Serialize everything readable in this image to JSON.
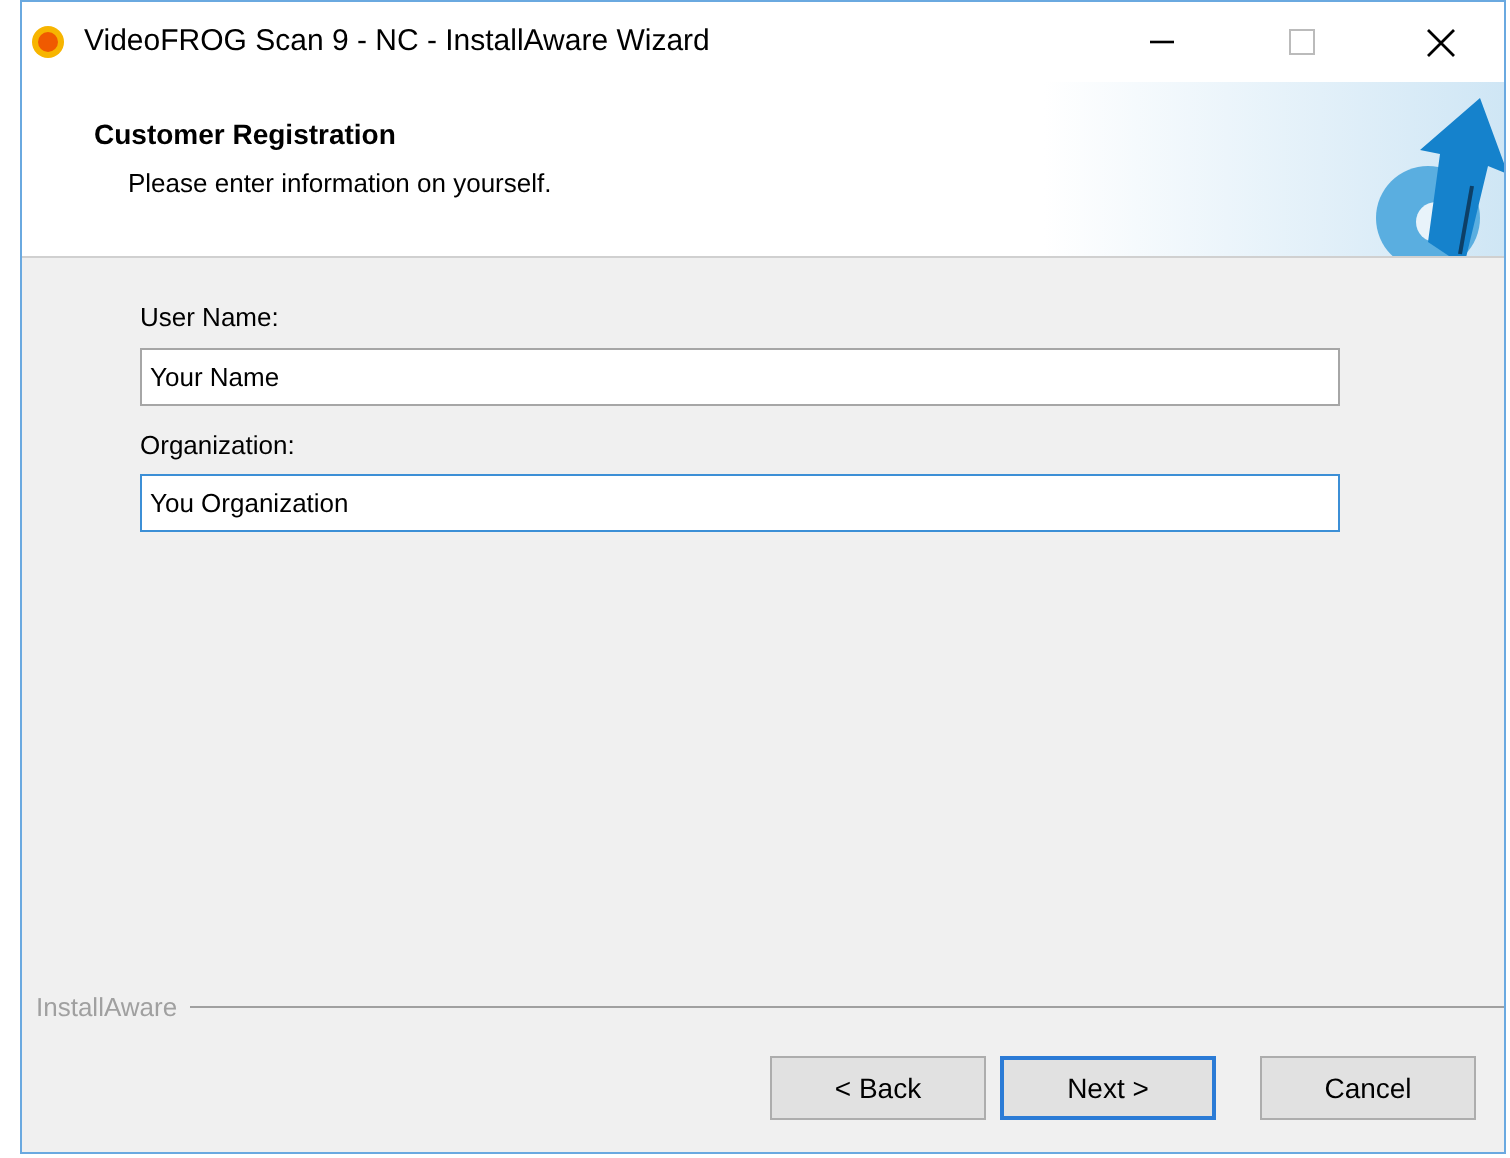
{
  "window": {
    "title": "VideoFROG Scan 9 - NC - InstallAware Wizard"
  },
  "header": {
    "title": "Customer Registration",
    "subtitle": "Please enter information on yourself."
  },
  "fields": [
    {
      "label": "User Name:",
      "value": "Your Name",
      "focused": false
    },
    {
      "label": "Organization:",
      "value": "You Organization",
      "focused": true
    }
  ],
  "brand": "InstallAware",
  "buttons": [
    {
      "label": "< Back",
      "default": false
    },
    {
      "label": "Next >",
      "default": true
    },
    {
      "label": "Cancel",
      "default": false
    }
  ]
}
